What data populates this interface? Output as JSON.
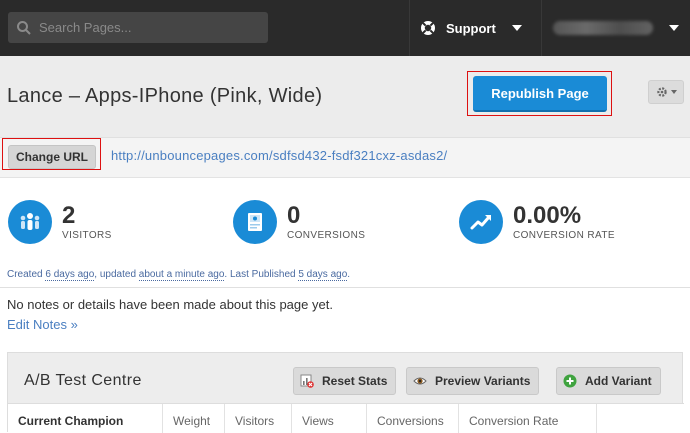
{
  "topbar": {
    "search_placeholder": "Search Pages...",
    "support_label": "Support"
  },
  "page": {
    "title": "Lance – Apps-IPhone (Pink, Wide)",
    "republish_label": "Republish Page",
    "change_url_label": "Change URL",
    "url": "http://unbouncepages.com/sdfsd432-fsdf321cxz-asdas2/"
  },
  "stats": [
    {
      "value": "2",
      "label": "VISITORS"
    },
    {
      "value": "0",
      "label": "CONVERSIONS"
    },
    {
      "value": "0.00%",
      "label": "CONVERSION RATE"
    }
  ],
  "meta": {
    "created_prefix": "Created ",
    "created": "6 days ago",
    "updated_prefix": ", updated ",
    "updated": "about a minute ago",
    "published_prefix": ". Last Published ",
    "published": "5 days ago",
    "suffix": "."
  },
  "notes": {
    "text": "No notes or details have been made about this page yet.",
    "edit_label": "Edit Notes »"
  },
  "ab": {
    "title": "A/B Test Centre",
    "reset_label": "Reset Stats",
    "preview_label": "Preview Variants",
    "add_label": "Add Variant",
    "columns": [
      "Current Champion",
      "Weight",
      "Visitors",
      "Views",
      "Conversions",
      "Conversion Rate"
    ]
  },
  "colors": {
    "accent": "#1a8bd6",
    "topbar": "#2a2a2a",
    "link": "#4a7fc1",
    "highlight": "#dd1111"
  }
}
